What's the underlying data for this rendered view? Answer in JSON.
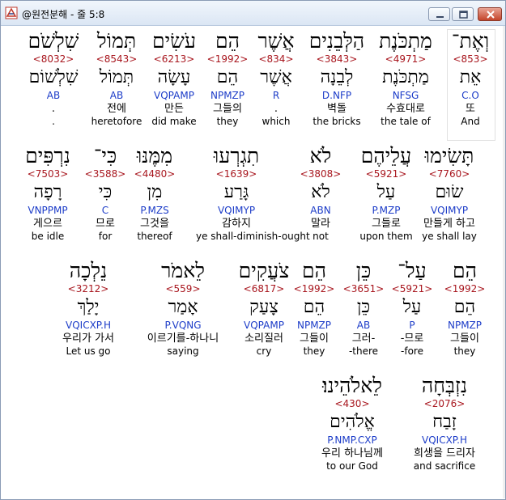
{
  "window": {
    "title": "@원전분해 - 줄 5:8",
    "icon": "app-logo-icon"
  },
  "rows": [
    {
      "cells": [
        {
          "heb": "וְאֶת־",
          "strong": "<853>",
          "lemma": "אֵת",
          "parse": "C.O",
          "kor": "또",
          "eng": "And"
        },
        {
          "heb": "מַתְכֹּנֶת",
          "strong": "<4971>",
          "lemma": "מַתְכֹּנֶת",
          "parse": "NFSG",
          "kor": "수효대로",
          "eng": "the tale of"
        },
        {
          "heb": "הַלְּבֵנִים",
          "strong": "<3843>",
          "lemma": "לְבֵנָה",
          "parse": "D.NFP",
          "kor": "벽돌",
          "eng": "the bricks"
        },
        {
          "heb": "אֲשֶׁר",
          "strong": "<834>",
          "lemma": "אֲשֶׁר",
          "parse": "R",
          "kor": ".",
          "eng": "which"
        },
        {
          "heb": "הֵם",
          "strong": "<1992>",
          "lemma": "הֵם",
          "parse": "NPMZP",
          "kor": "그들의",
          "eng": "they"
        },
        {
          "heb": "עֹשִׂים",
          "strong": "<6213>",
          "lemma": "עָשָׂה",
          "parse": "VQPAMP",
          "kor": "만든",
          "eng": "did make"
        },
        {
          "heb": "תְּמוֹל",
          "strong": "<8543>",
          "lemma": "תְּמוֹל",
          "parse": "AB",
          "kor": "전에",
          "eng": "heretofore"
        },
        {
          "heb": "שִׁלְשֹׁם",
          "strong": "<8032>",
          "lemma": "שִׁלְשׁוֹם",
          "parse": "AB",
          "kor": ".",
          "eng": "."
        }
      ]
    },
    {
      "cells": [
        {
          "heb": "תָּשִׂימוּ",
          "strong": "<7760>",
          "lemma": "שׂוּם",
          "parse": "VQIMYP",
          "kor": "만들게 하고",
          "eng": "ye shall lay"
        },
        {
          "heb": "עֲלֵיהֶם",
          "strong": "<5921>",
          "lemma": "עַל",
          "parse": "P.MZP",
          "kor": "그들로",
          "eng": "upon them"
        },
        {
          "heb": "לֹא",
          "strong": "<3808>",
          "lemma": "לֹא",
          "parse": "ABN",
          "kor": "말라",
          "eng": "not"
        },
        {
          "heb": "תִגְרְעוּ",
          "strong": "<1639>",
          "lemma": "גָּרַע",
          "parse": "VQIMYP",
          "kor": "감하지",
          "eng": "ye shall-diminish-ought"
        },
        {
          "heb": "מִמֶּנּוּ",
          "strong": "<4480>",
          "lemma": "מִן",
          "parse": "P.MZS",
          "kor": "그것을",
          "eng": "thereof"
        },
        {
          "heb": "כִּי־",
          "strong": "<3588>",
          "lemma": "כִּי",
          "parse": "C",
          "kor": "므로",
          "eng": "for"
        },
        {
          "heb": "נִרְפִּים",
          "strong": "<7503>",
          "lemma": "רָפָה",
          "parse": "VNPPMP",
          "kor": "게으르",
          "eng": "be idle"
        }
      ]
    },
    {
      "cells": [
        {
          "heb": "הֵם",
          "strong": "<1992>",
          "lemma": "הֵם",
          "parse": "NPMZP",
          "kor": "그들이",
          "eng": "they"
        },
        {
          "heb": "עַל־",
          "strong": "<5921>",
          "lemma": "עַל",
          "parse": "P",
          "kor": "-므로",
          "eng": "-fore"
        },
        {
          "heb": "כֵּן",
          "strong": "<3651>",
          "lemma": "כֵּן",
          "parse": "AB",
          "kor": "그러-",
          "eng": "-there"
        },
        {
          "heb": "הֵם",
          "strong": "<1992>",
          "lemma": "הֵם",
          "parse": "NPMZP",
          "kor": "그들이",
          "eng": "they"
        },
        {
          "heb": "צֹעֲקִים",
          "strong": "<6817>",
          "lemma": "צָעַק",
          "parse": "VQPAMP",
          "kor": "소리질러",
          "eng": "cry"
        },
        {
          "heb": "לֵאמֹר",
          "strong": "<559>",
          "lemma": "אָמַר",
          "parse": "P.VQNG",
          "kor": "이르기를-하나니",
          "eng": "saying"
        },
        {
          "heb": "נֵלְכָה",
          "strong": "<3212>",
          "lemma": "יָלַךְ",
          "parse": "VQICXP.H",
          "kor": "우리가 가서",
          "eng": "Let us go"
        }
      ]
    },
    {
      "cells": [
        {
          "heb": "נִזְבְּחָה",
          "strong": "<2076>",
          "lemma": "זָבַח",
          "parse": "VQICXP.H",
          "kor": "희생을 드리자",
          "eng": "and sacrifice"
        },
        {
          "heb": "לֵאלֹהֵינוּ׃",
          "strong": "<430>",
          "lemma": "אֱלֹהִים",
          "parse": "P.NMP.CXP",
          "kor": "우리 하나님께",
          "eng": "to our God"
        }
      ]
    }
  ],
  "colors": {
    "strong": "#a8161e",
    "parse": "#1c3cc8",
    "text": "#000000"
  }
}
